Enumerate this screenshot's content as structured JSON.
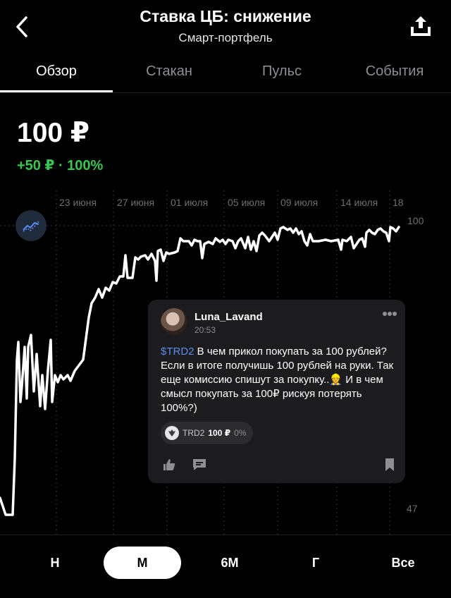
{
  "header": {
    "title": "Ставка ЦБ: снижение",
    "subtitle": "Смарт-портфель"
  },
  "tabs": [
    {
      "label": "Обзор",
      "active": true
    },
    {
      "label": "Стакан",
      "active": false
    },
    {
      "label": "Пульс",
      "active": false
    },
    {
      "label": "События",
      "active": false
    }
  ],
  "summary": {
    "price": "100 ₽",
    "change": "+50 ₽ · 100%"
  },
  "chart": {
    "date_labels": [
      "23 июня",
      "27 июня",
      "01 июля",
      "05 июля",
      "09 июля",
      "14 июля",
      "18"
    ],
    "y_max_label": "100",
    "y_min_label": "47",
    "line_color": "#ffffff"
  },
  "post": {
    "author": "Luna_Lavand",
    "time": "20:53",
    "ticker": "$TRD2",
    "text": " В чем прикол покупать за 100 рублей? Если в итоге получишь 100 рублей на руки. Так еще комиссию спишут за покупку..👷 И в чем смысл покупать за 100₽ рискуя потерять 100%?)",
    "asset": {
      "ticker": "TRD2",
      "price": "100 ₽",
      "change": "0%"
    }
  },
  "periods": [
    {
      "label": "Н",
      "active": false
    },
    {
      "label": "М",
      "active": true
    },
    {
      "label": "6М",
      "active": false
    },
    {
      "label": "Г",
      "active": false
    },
    {
      "label": "Все",
      "active": false
    }
  ],
  "colors": {
    "positive": "#3cc452",
    "accent_link": "#5a8dee",
    "background": "#000000",
    "card": "#1c1c1e"
  }
}
